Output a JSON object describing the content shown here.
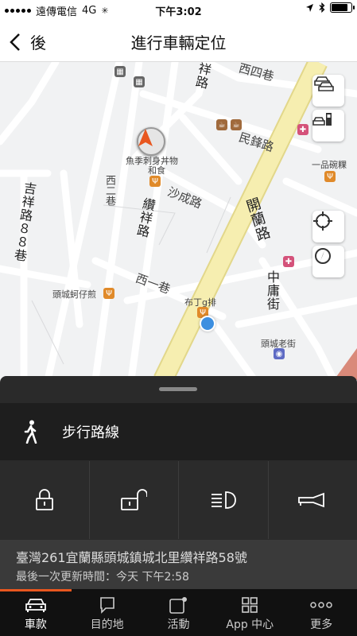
{
  "status_bar": {
    "carrier": "遠傳電信",
    "network": "4G",
    "time": "下午3:02"
  },
  "nav": {
    "back_label": "後",
    "title": "進行車輛定位"
  },
  "map": {
    "road_labels": [
      "西四巷",
      "民鋒路",
      "沙成路",
      "開蘭路",
      "纘祥路",
      "吉祥路８８巷",
      "西一巷",
      "西二巷",
      "中庸街",
      "祥路"
    ],
    "poi_labels": [
      "魚季刺身丼物",
      "和食",
      "一品碗粿",
      "頭城蚵仔煎",
      "布丁g排",
      "頭城老街"
    ]
  },
  "sheet": {
    "walk_route_label": "步行路線",
    "controls": [
      {
        "name": "lock",
        "icon": "lock-icon"
      },
      {
        "name": "unlock",
        "icon": "unlock-icon"
      },
      {
        "name": "headlights",
        "icon": "headlight-icon"
      },
      {
        "name": "horn",
        "icon": "horn-icon"
      }
    ],
    "address": "臺灣261宜蘭縣頭城鎮城北里纘祥路58號",
    "last_update": "最後一次更新時間：今天 下午2:58"
  },
  "tabs": [
    {
      "label": "車款",
      "icon": "car-icon",
      "active": true
    },
    {
      "label": "目的地",
      "icon": "chat-icon",
      "active": false
    },
    {
      "label": "活動",
      "icon": "activity-icon",
      "active": false
    },
    {
      "label": "App 中心",
      "icon": "grid-icon",
      "active": false
    },
    {
      "label": "更多",
      "icon": "more-icon",
      "active": false
    }
  ],
  "colors": {
    "accent": "#e8571f",
    "sheet_bg": "#2a2a2a",
    "tabbar_bg": "#111111",
    "location_dot": "#3d8fe0",
    "main_road": "#f6eeb0"
  }
}
